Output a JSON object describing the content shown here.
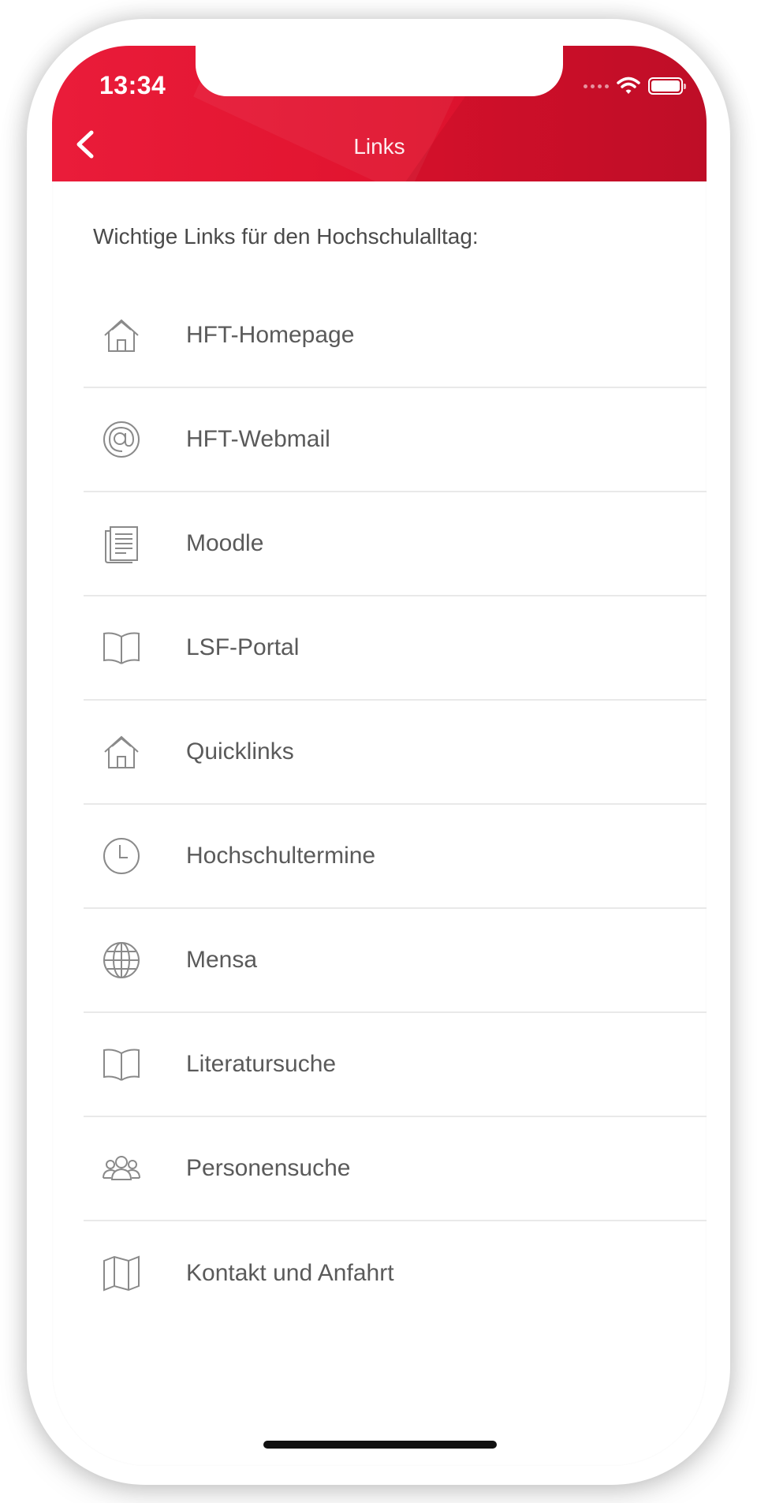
{
  "status_bar": {
    "time": "13:34"
  },
  "nav": {
    "title": "Links",
    "back_icon": "chevron-left-icon"
  },
  "intro_text": "Wichtige Links für den Hochschulalltag:",
  "colors": {
    "header_red": "#e0132e",
    "text": "#5a5a5a",
    "icon": "#8a8a8a",
    "divider": "#e9e9e9"
  },
  "links": [
    {
      "label": "HFT-Homepage",
      "icon": "home-icon"
    },
    {
      "label": "HFT-Webmail",
      "icon": "at-sign-icon"
    },
    {
      "label": "Moodle",
      "icon": "document-icon"
    },
    {
      "label": "LSF-Portal",
      "icon": "book-icon"
    },
    {
      "label": "Quicklinks",
      "icon": "home-icon"
    },
    {
      "label": "Hochschultermine",
      "icon": "clock-icon"
    },
    {
      "label": "Mensa",
      "icon": "globe-icon"
    },
    {
      "label": "Literatursuche",
      "icon": "book-icon"
    },
    {
      "label": "Personensuche",
      "icon": "people-icon"
    },
    {
      "label": "Kontakt und Anfahrt",
      "icon": "map-icon"
    }
  ]
}
